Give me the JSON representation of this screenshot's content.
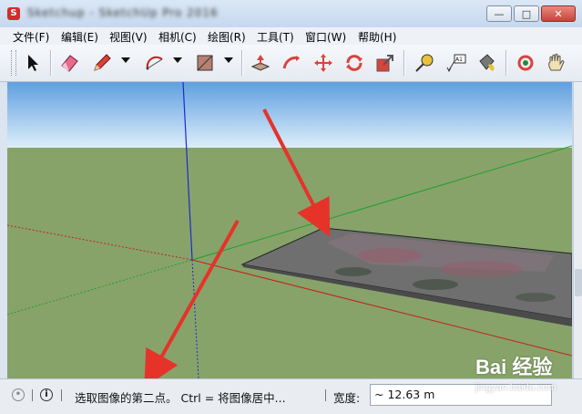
{
  "window": {
    "title": "Sketchup - SketchUp Pro 2016",
    "minimize": "—",
    "maximize": "□",
    "close": "✕"
  },
  "menu": [
    "文件(F)",
    "编辑(E)",
    "视图(V)",
    "相机(C)",
    "绘图(R)",
    "工具(T)",
    "窗口(W)",
    "帮助(H)"
  ],
  "toolbar": {
    "tools": [
      {
        "name": "select-icon"
      },
      {
        "name": "eraser-icon"
      },
      {
        "name": "pencil-icon",
        "dropdown": true
      },
      {
        "name": "arc-icon",
        "dropdown": true
      },
      {
        "name": "rectangle-icon",
        "dropdown": true
      },
      {
        "name": "push-pull-icon"
      },
      {
        "name": "follow-me-icon"
      },
      {
        "name": "move-icon"
      },
      {
        "name": "rotate-icon"
      },
      {
        "name": "scale-icon"
      },
      {
        "name": "tape-measure-icon"
      },
      {
        "name": "text-icon",
        "label": "A1"
      },
      {
        "name": "paint-bucket-icon"
      },
      {
        "name": "orbit-icon"
      },
      {
        "name": "pan-icon"
      }
    ]
  },
  "colors": {
    "sky_top": "#5f9fe0",
    "sky_bottom": "#ddeef9",
    "ground": "#87a36a",
    "axis_red": "#c8201c",
    "axis_green": "#22a02a",
    "axis_blue": "#1a2bd0",
    "arrow_red": "#e5332a"
  },
  "statusbar": {
    "message": "选取图像的第二点。 Ctrl = 将图像居中...",
    "measure_label": "宽度:",
    "measure_value": "~ 12.63 m",
    "info_icon": "i"
  },
  "watermark": {
    "logo": "Bai 经验",
    "url": "jingyan.baidu.com"
  }
}
